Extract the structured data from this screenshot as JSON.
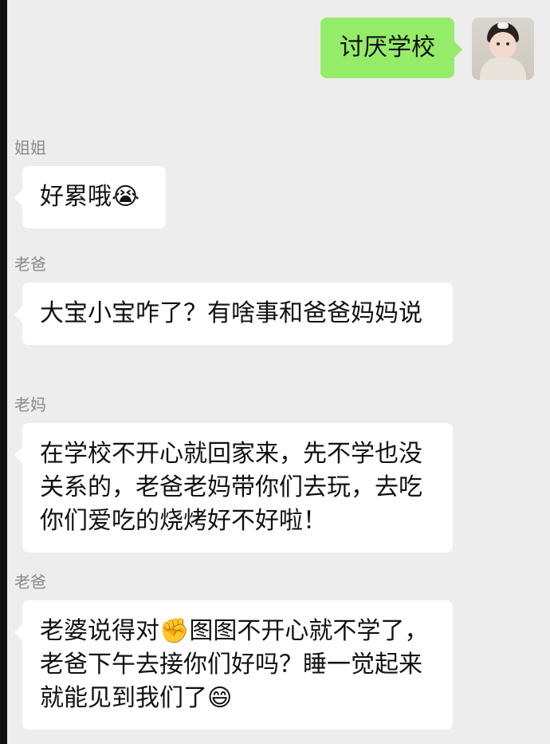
{
  "outgoing": {
    "text": "讨厌学校"
  },
  "messages": [
    {
      "sender": "姐姐",
      "text": "好累哦😭"
    },
    {
      "sender": "老爸",
      "text": "大宝小宝咋了？有啥事和爸爸妈妈说"
    },
    {
      "sender": "老妈",
      "text": "在学校不开心就回家来，先不学也没关系的，老爸老妈带你们去玩，去吃你们爱吃的烧烤好不好啦！"
    },
    {
      "sender": "老爸",
      "text": "老婆说得对✊图图不开心就不学了，老爸下午去接你们好吗？睡一觉起来就能见到我们了😄"
    }
  ]
}
